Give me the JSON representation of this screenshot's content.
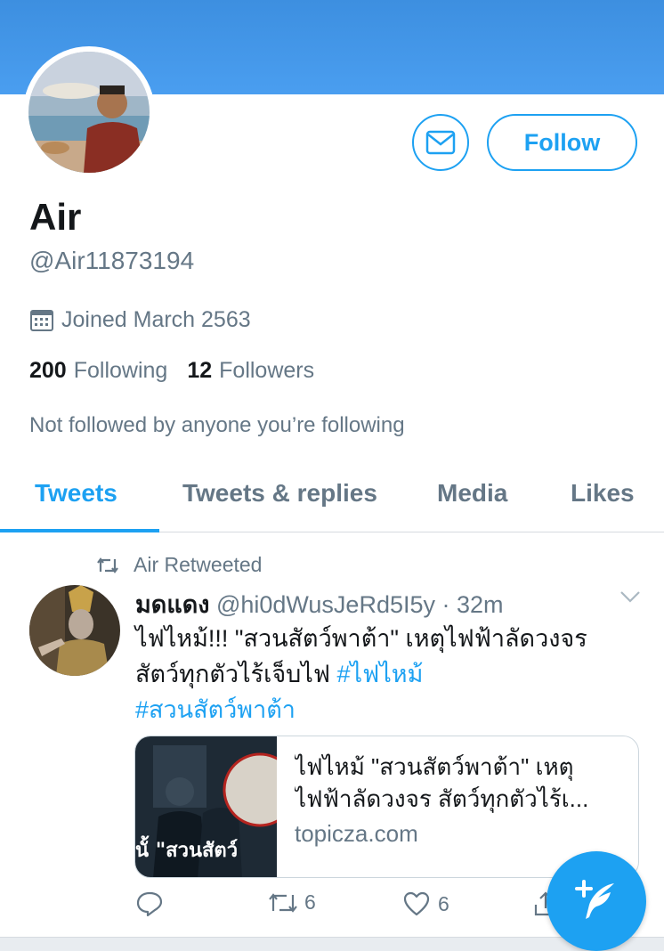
{
  "profile": {
    "name": "Air",
    "handle": "@Air11873194",
    "joined": "Joined March 2563",
    "following_count": "200",
    "following_label": "Following",
    "followers_count": "12",
    "followers_label": "Followers",
    "not_followed_text": "Not followed by anyone you’re following",
    "follow_label": "Follow"
  },
  "tabs": [
    {
      "label": "Tweets",
      "active": true
    },
    {
      "label": "Tweets & replies",
      "active": false
    },
    {
      "label": "Media",
      "active": false
    },
    {
      "label": "Likes",
      "active": false
    }
  ],
  "tweet": {
    "retweet_context": "Air Retweeted",
    "author_name": "มดแดง",
    "author_handle": "@hi0dWusJeRd5I5y",
    "time": "· 32m",
    "text_plain": "ไฟไหม้!!! \"สวนสัตว์พาต้า\" เหตุไฟฟ้าลัดวงจร สัตว์ทุกตัวไร้เจ็บไฟ ",
    "hashtag1": "#ไฟไหม้",
    "hashtag2": "#สวนสัตว์พาต้า",
    "card": {
      "title": "ไฟไหม้ \"สวนสัตว์พาต้า\" เหตุไฟฟ้าลัดวงจร สัตว์ทุกตัวไร้เ...",
      "domain": "topicza.com",
      "image_text": "นั้ \"สวนสัตว์"
    },
    "retweet_count": "6",
    "like_count": "6"
  },
  "colors": {
    "accent": "#1da1f2",
    "banner": "#4a9ef0",
    "secondary_text": "#657786"
  },
  "icons": [
    "mail-icon",
    "calendar-icon",
    "retweet-icon",
    "chevron-down-icon",
    "reply-icon",
    "like-icon",
    "share-icon",
    "compose-icon"
  ]
}
